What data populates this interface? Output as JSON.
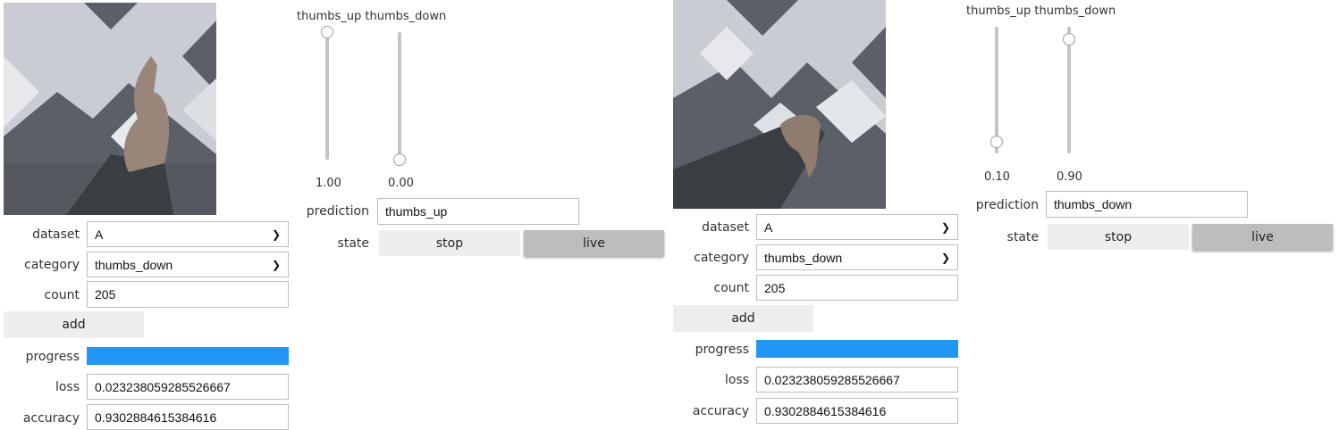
{
  "colors": {
    "progress": "#2196f3",
    "active_button": "#bdbdbd",
    "button": "#eeeeee"
  },
  "panels": [
    {
      "sliders": {
        "title": "thumbs_up thumbs_down",
        "thumbs_up": 1.0,
        "thumbs_down": 0.0,
        "thumbs_up_text": "1.00",
        "thumbs_down_text": "0.00"
      },
      "prediction_label": "prediction",
      "prediction": "thumbs_up",
      "state_label": "state",
      "stop_label": "stop",
      "live_label": "live",
      "dataset_label": "dataset",
      "dataset": "A",
      "category_label": "category",
      "category": "thumbs_down",
      "count_label": "count",
      "count": "205",
      "add_label": "add",
      "progress_label": "progress",
      "progress": 1.0,
      "loss_label": "loss",
      "loss": "0.023238059285526667",
      "accuracy_label": "accuracy",
      "accuracy": "0.9302884615384616"
    },
    {
      "sliders": {
        "title": "thumbs_up thumbs_down",
        "thumbs_up": 0.1,
        "thumbs_down": 0.9,
        "thumbs_up_text": "0.10",
        "thumbs_down_text": "0.90"
      },
      "prediction_label": "prediction",
      "prediction": "thumbs_down",
      "state_label": "state",
      "stop_label": "stop",
      "live_label": "live",
      "dataset_label": "dataset",
      "dataset": "A",
      "category_label": "category",
      "category": "thumbs_down",
      "count_label": "count",
      "count": "205",
      "add_label": "add",
      "progress_label": "progress",
      "progress": 1.0,
      "loss_label": "loss",
      "loss": "0.023238059285526667",
      "accuracy_label": "accuracy",
      "accuracy": "0.9302884615384616"
    }
  ]
}
